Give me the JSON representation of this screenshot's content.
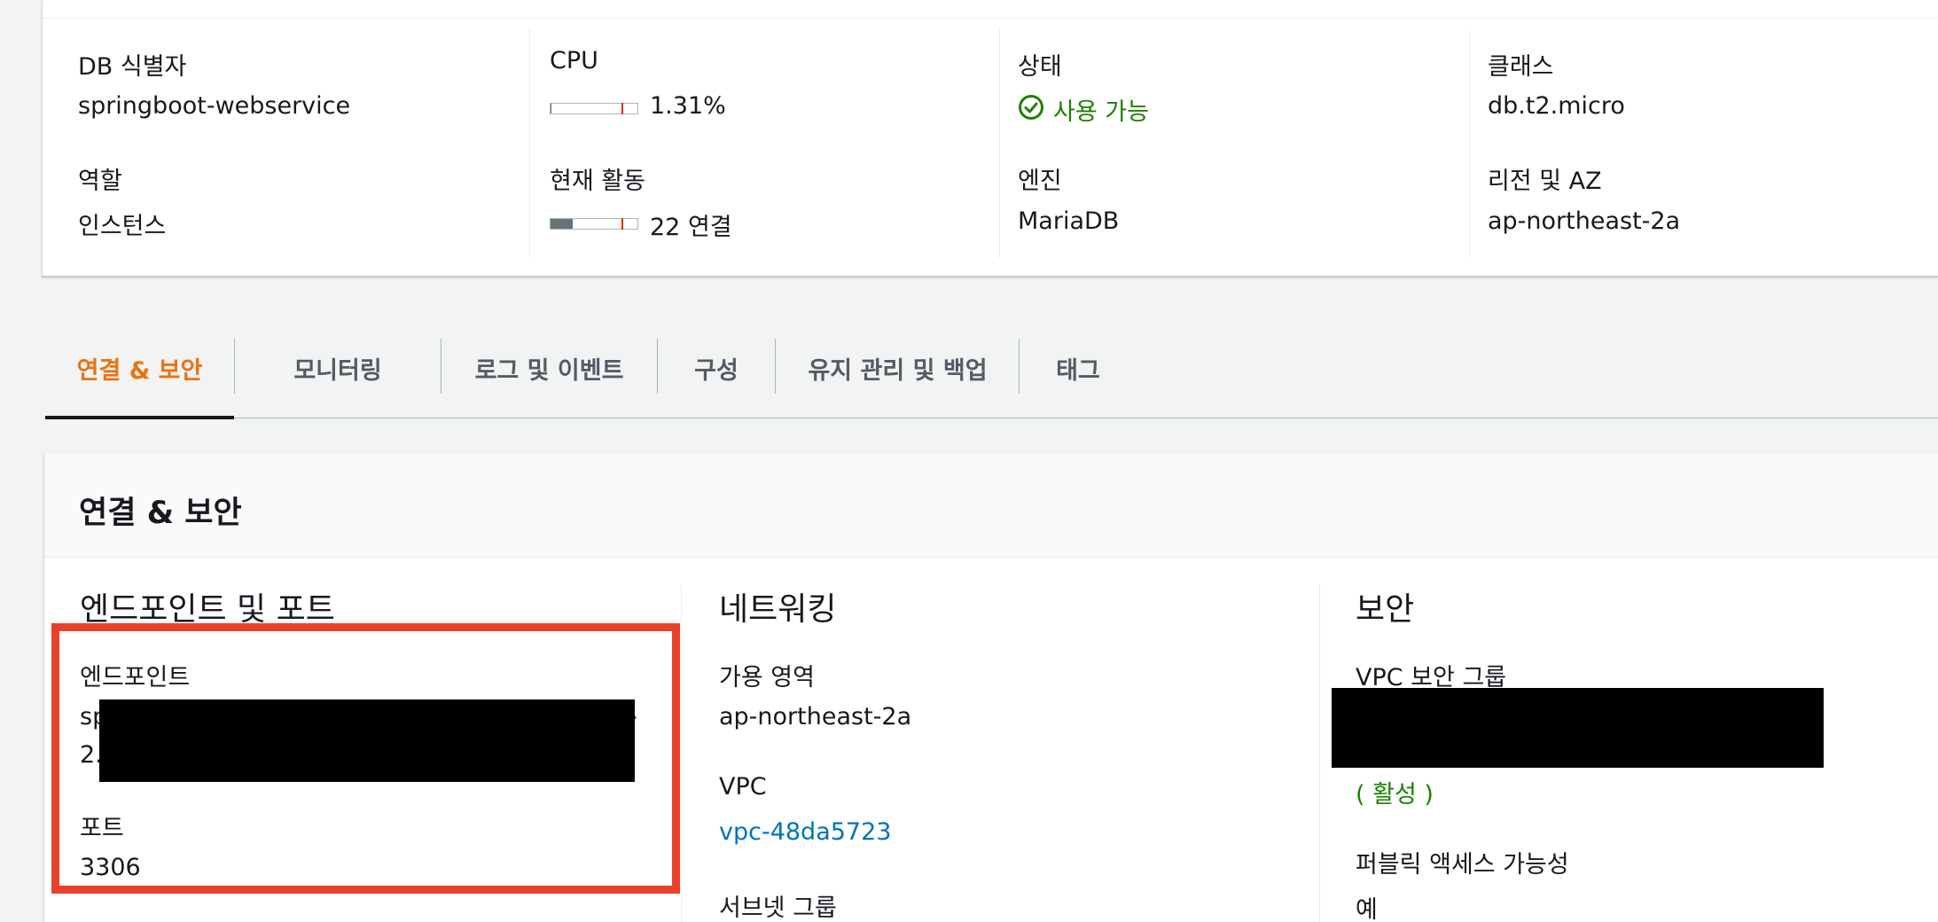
{
  "summary": {
    "db_identifier": {
      "label": "DB 식별자",
      "value": "springboot-webservice"
    },
    "role": {
      "label": "역할",
      "value": "인스턴스"
    },
    "cpu": {
      "label": "CPU",
      "value": "1.31%",
      "fill_fraction": 0.0131
    },
    "activity": {
      "label": "현재 활동",
      "value": "22 연결",
      "fill_fraction": 0.25
    },
    "status": {
      "label": "상태",
      "value": "사용 가능",
      "icon": "check-circle-icon",
      "color": "#1d8102"
    },
    "engine": {
      "label": "엔진",
      "value": "MariaDB"
    },
    "class": {
      "label": "클래스",
      "value": "db.t2.micro"
    },
    "region": {
      "label": "리전 및 AZ",
      "value": "ap-northeast-2a"
    }
  },
  "tabs": [
    {
      "label": "연결 & 보안",
      "active": true
    },
    {
      "label": "모니터링"
    },
    {
      "label": "로그 및 이벤트"
    },
    {
      "label": "구성"
    },
    {
      "label": "유지 관리 및 백업"
    },
    {
      "label": "태그"
    }
  ],
  "panel": {
    "title": "연결 & 보안",
    "endpoints": {
      "title": "엔드포인트 및 포트",
      "endpoint_label": "엔드포인트",
      "endpoint_visible_start_1": "sp",
      "endpoint_visible_end_1": "-",
      "endpoint_visible_start_2": "2.",
      "port_label": "포트",
      "port_value": "3306"
    },
    "networking": {
      "title": "네트워킹",
      "az_label": "가용 영역",
      "az_value": "ap-northeast-2a",
      "vpc_label": "VPC",
      "vpc_value": "vpc-48da5723",
      "subnet_label": "서브넷 그룹"
    },
    "security": {
      "title": "보안",
      "sg_label": "VPC 보안 그룹",
      "sg_status": "( 활성 )",
      "public_label": "퍼블릭 액세스 가능성",
      "public_value": "예"
    }
  },
  "colors": {
    "accent_orange": "#ec7211",
    "link_blue": "#0073bb",
    "success_green": "#1d8102",
    "highlight_red": "#e8402a"
  }
}
